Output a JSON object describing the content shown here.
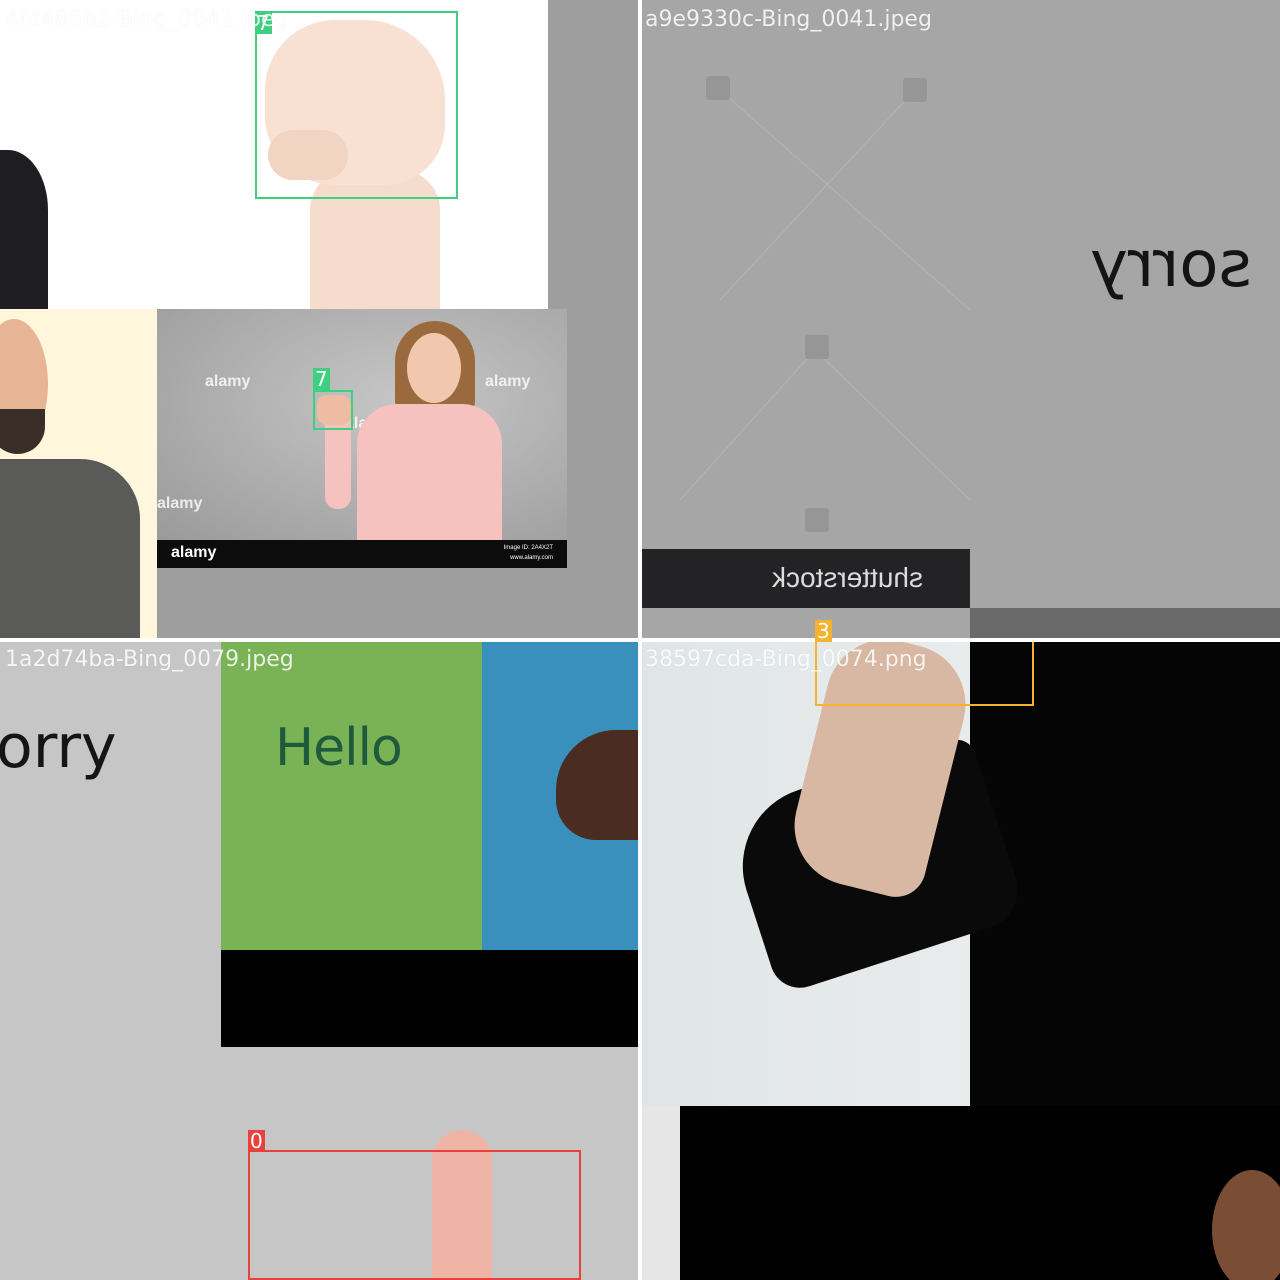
{
  "tiles": [
    {
      "filename": "4fd485b2-Bing_0041.jpeg",
      "boxes": [
        {
          "label": "7",
          "color": "#3ecf80"
        },
        {
          "label": "7",
          "color": "#3ecf80"
        }
      ],
      "inset_watermark": "alamy",
      "inset_footer": {
        "brand": "alamy",
        "image_id": "Image ID: 2A4X2T",
        "site": "www.alamy.com"
      }
    },
    {
      "filename": "a9e9330c-Bing_0041.jpeg",
      "mirrored_text": "sorry",
      "mirrored_brand": "shutterstock"
    },
    {
      "filename": "1a2d74ba-Bing_0079.jpeg",
      "partial_text": "orry",
      "hello_text": "Hello",
      "boxes": [
        {
          "label": "0",
          "color": "#e8413c"
        }
      ]
    },
    {
      "filename": "38597cda-Bing_0074.png",
      "boxes": [
        {
          "label": "3",
          "color": "#f5b22d"
        }
      ]
    }
  ]
}
